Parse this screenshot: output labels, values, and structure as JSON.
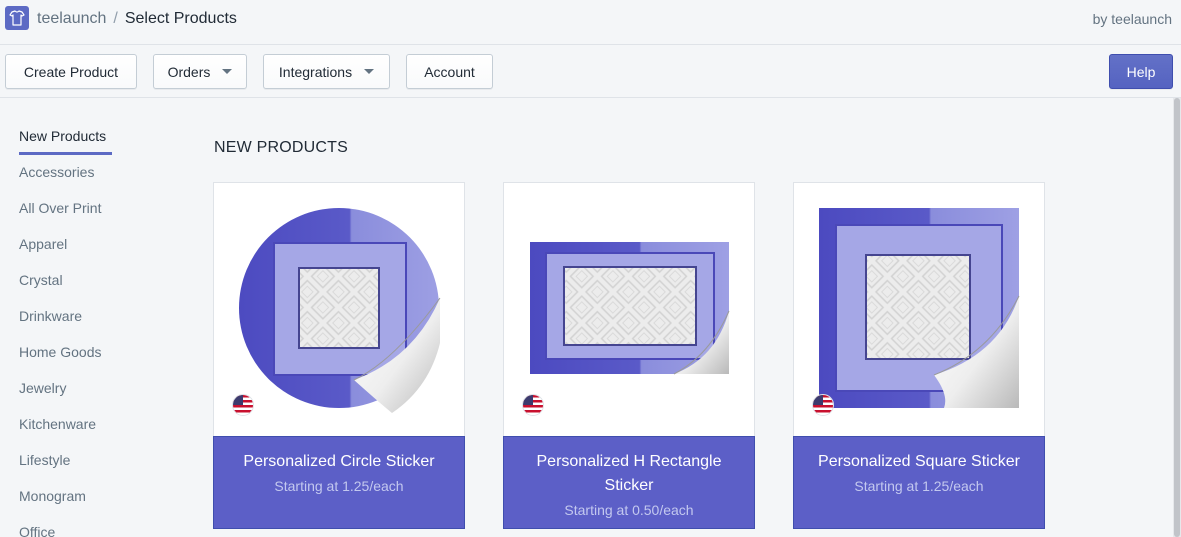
{
  "header": {
    "app_name": "teelaunch",
    "separator": "/",
    "page_title": "Select Products",
    "by_label": "by teelaunch"
  },
  "toolbar": {
    "create_product": "Create Product",
    "orders": "Orders",
    "integrations": "Integrations",
    "account": "Account",
    "help": "Help"
  },
  "sidebar": {
    "items": [
      {
        "label": "New Products",
        "active": true
      },
      {
        "label": "Accessories"
      },
      {
        "label": "All Over Print"
      },
      {
        "label": "Apparel"
      },
      {
        "label": "Crystal"
      },
      {
        "label": "Drinkware"
      },
      {
        "label": "Home Goods"
      },
      {
        "label": "Jewelry"
      },
      {
        "label": "Kitchenware"
      },
      {
        "label": "Lifestyle"
      },
      {
        "label": "Monogram"
      },
      {
        "label": "Office"
      }
    ]
  },
  "main": {
    "section_title": "NEW PRODUCTS",
    "products": [
      {
        "name": "Personalized Circle Sticker",
        "price": "Starting at 1.25/each",
        "shape": "circle",
        "flag_icon": "us-flag-icon"
      },
      {
        "name": "Personalized H Rectangle Sticker",
        "price": "Starting at 0.50/each",
        "shape": "rectangle",
        "flag_icon": "us-flag-icon"
      },
      {
        "name": "Personalized Square Sticker",
        "price": "Starting at 1.25/each",
        "shape": "square",
        "flag_icon": "us-flag-icon"
      }
    ]
  },
  "colors": {
    "accent": "#5c6ac4",
    "card_footer": "#5c5fc7",
    "sticker_dark": "#5150c2",
    "sticker_light": "#a6a8e6"
  }
}
